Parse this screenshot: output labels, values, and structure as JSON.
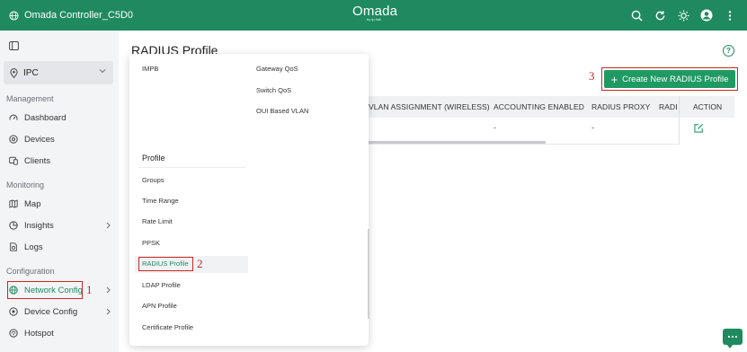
{
  "topbar": {
    "site_name": "Omada Controller_C5D0",
    "brand": "Omada",
    "brand_sub": "by tp-link"
  },
  "sidebar": {
    "site_value": "IPC",
    "sections": {
      "management": "Management",
      "monitoring": "Monitoring",
      "configuration": "Configuration"
    },
    "items": [
      {
        "label": "Dashboard"
      },
      {
        "label": "Devices"
      },
      {
        "label": "Clients"
      },
      {
        "label": "Map"
      },
      {
        "label": "Insights"
      },
      {
        "label": "Logs"
      },
      {
        "label": "Network Config"
      },
      {
        "label": "Device Config"
      },
      {
        "label": "Hotspot"
      }
    ]
  },
  "markers": {
    "one": "1",
    "two": "2",
    "three": "3"
  },
  "main": {
    "title": "RADIUS Profile",
    "create_button": "Create New RADIUS Profile",
    "table": {
      "columns": [
        "VLAN ASSIGNMENT (WIRELESS)",
        "ACCOUNTING ENABLED",
        "RADIUS PROXY",
        "RADI",
        "ACTION"
      ],
      "row": {
        "accounting": "-",
        "proxy": "-"
      }
    }
  },
  "menu": {
    "col1_top": "IMPB",
    "col2": [
      "Gateway QoS",
      "Switch QoS",
      "OUI Based VLAN"
    ],
    "profile_heading": "Profile",
    "profile_items": [
      "Groups",
      "Time Range",
      "Rate Limit",
      "PPSK",
      "RADIUS Profile",
      "LDAP Profile",
      "APN Profile",
      "Certificate Profile"
    ]
  },
  "colors": {
    "brand_green": "#1f8a5f",
    "highlight_red": "#c62828"
  }
}
